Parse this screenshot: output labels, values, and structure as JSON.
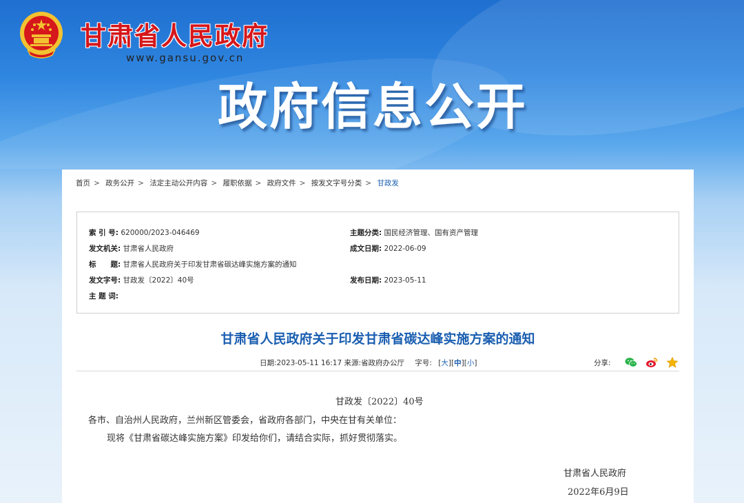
{
  "site": {
    "title": "甘肃省人民政府",
    "url": "www.gansu.gov.cn",
    "banner_title": "政府信息公开"
  },
  "breadcrumb": [
    "首页",
    "政务公开",
    "法定主动公开内容",
    "履职依据",
    "政府文件",
    "按发文字号分类",
    "甘政发"
  ],
  "meta": {
    "index_label": "索 引 号:",
    "index_value": "620000/2023-046469",
    "topic_label": "主题分类:",
    "topic_value": "国民经济管理、国有资产管理",
    "issuer_label": "发文机关:",
    "issuer_value": "甘肃省人民政府",
    "written_label": "成文日期:",
    "written_value": "2022-06-09",
    "title_label": "标　　题:",
    "title_value": "甘肃省人民政府关于印发甘肃省碳达峰实施方案的通知",
    "docno_label": "发文字号:",
    "docno_value": "甘政发〔2022〕40号",
    "publish_label": "发布日期:",
    "publish_value": "2023-05-11",
    "keywords_label": "主 题 词:",
    "keywords_value": ""
  },
  "article": {
    "title": "甘肃省人民政府关于印发甘肃省碳达峰实施方案的通知",
    "date_label": "日期:",
    "date_value": "2023-05-11 16:17",
    "source_label": "来源:",
    "source_value": "省政府办公厅",
    "fontsize_label": "字号:",
    "size_large": "大",
    "size_medium": "中",
    "size_small": "小",
    "share_label": "分享:",
    "doc_number": "甘政发〔2022〕40号",
    "recipients": "各市、自治州人民政府，兰州新区管委会，省政府各部门，中央在甘有关单位：",
    "body": "现将《甘肃省碳达峰实施方案》印发给你们，请结合实际，抓好贯彻落实。",
    "signature": "甘肃省人民政府",
    "sign_date": "2022年6月9日"
  },
  "colors": {
    "brand_red": "#d6171b",
    "link_blue": "#1a5eb0",
    "wechat_green": "#29b34a",
    "weibo_red": "#e6162d",
    "star_gold": "#f4b400"
  },
  "icons": [
    "national-emblem-icon",
    "wechat-icon",
    "weibo-icon",
    "favorite-star-icon"
  ]
}
